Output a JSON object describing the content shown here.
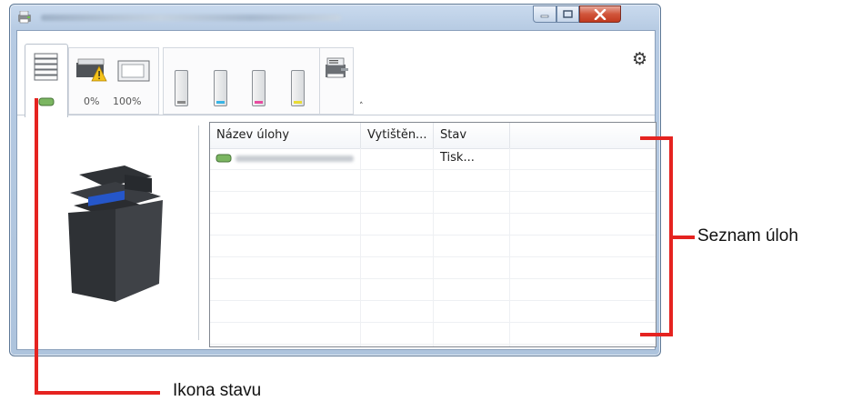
{
  "window": {
    "title": ""
  },
  "toolbar": {
    "percent_min": "0%",
    "percent_max": "100%"
  },
  "toner_colors": [
    "#8a8a8a",
    "#38b5e6",
    "#e84ba0",
    "#e9dc35"
  ],
  "icons": {
    "app": "printer-app-icon",
    "jobs_tab": "jobs-stack-icon",
    "tray_warning": "paper-tray-warning-icon",
    "tray": "paper-tray-icon",
    "device": "printer-device-icon",
    "settings": "gear-icon",
    "collapse": "chevron-up-icon",
    "status": "status-indicator-icon"
  },
  "job_list": {
    "columns": [
      "Název úlohy",
      "Vytištěn...",
      "Stav"
    ],
    "rows": [
      {
        "name": "",
        "printed": "",
        "status": "Tisk..."
      }
    ]
  },
  "annotations": {
    "job_list_label": "Seznam úloh",
    "status_icon_label": "Ikona stavu"
  },
  "colors": {
    "annotation": "#e52320",
    "status_icon": "#6ab04c"
  }
}
